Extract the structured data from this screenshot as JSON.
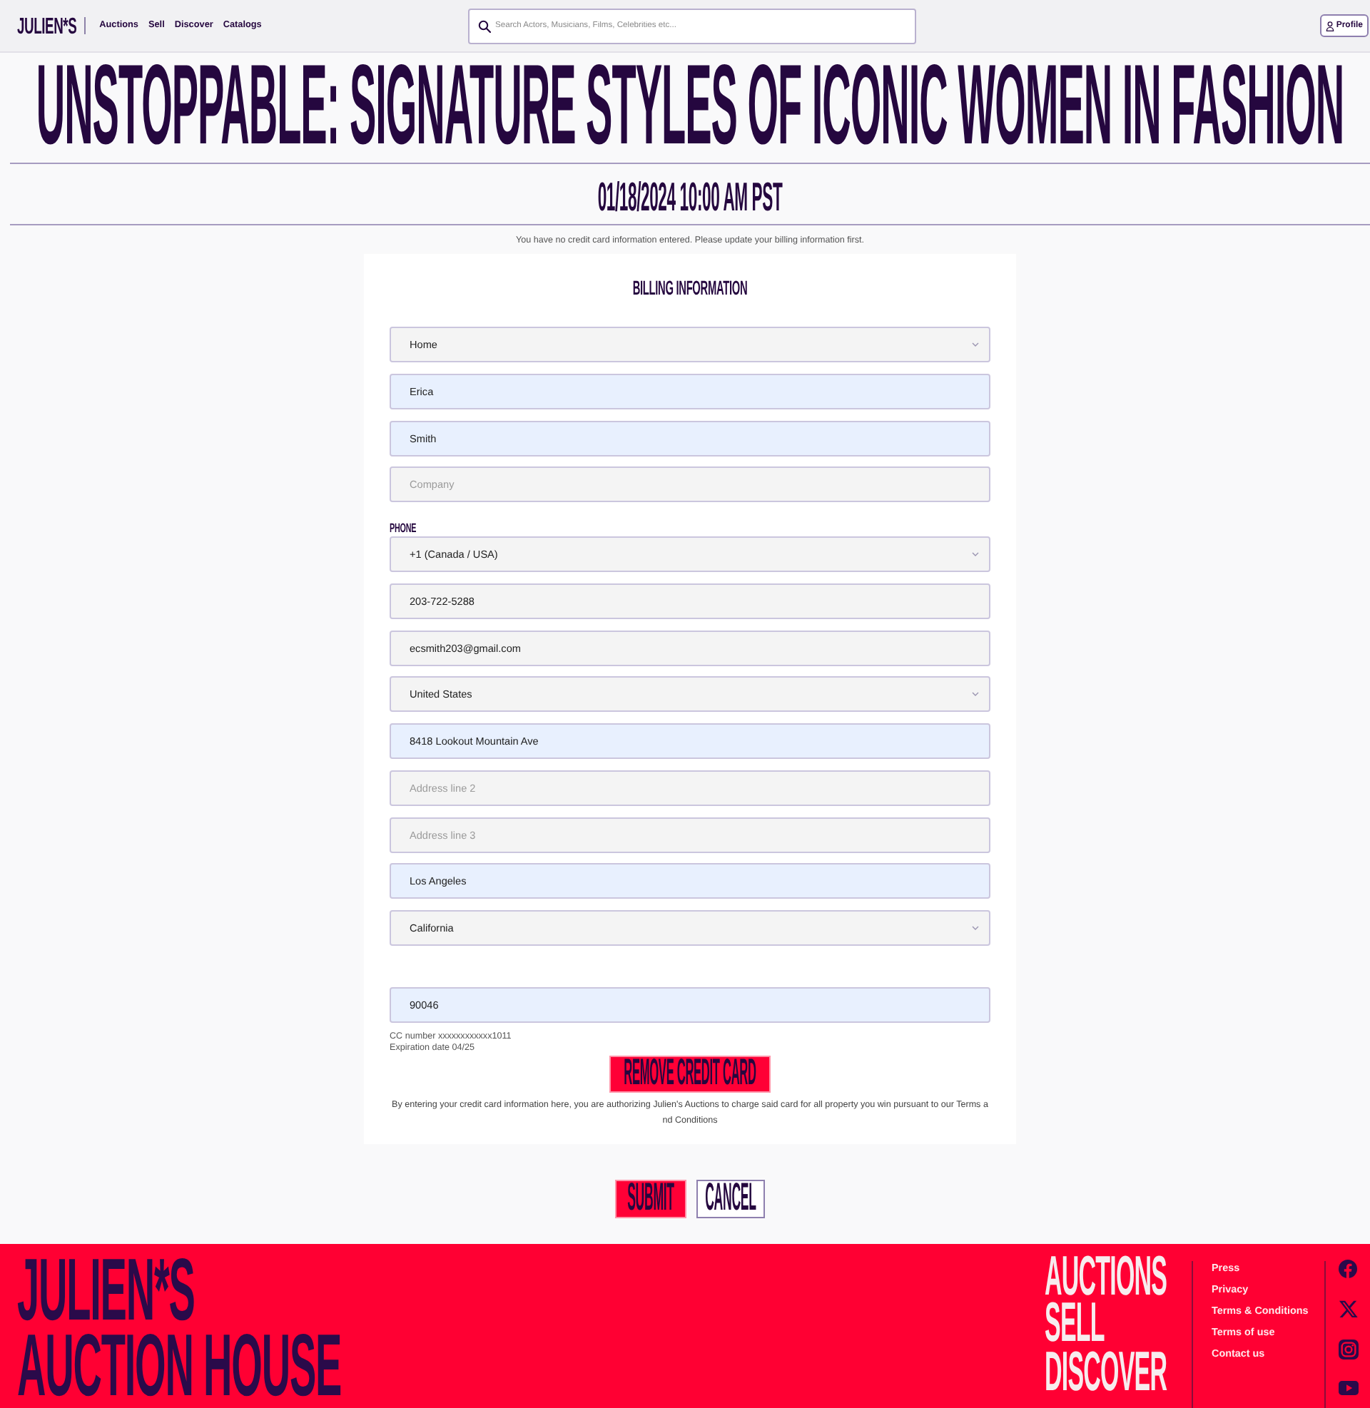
{
  "header": {
    "logo": "JULIEN*S",
    "nav": [
      "Auctions",
      "Sell",
      "Discover",
      "Catalogs"
    ],
    "search": {
      "placeholder": "Search Actors, Musicians, Films, Celebrities etc..."
    },
    "profile": "Profile"
  },
  "banner": {
    "title": "UNSTOPPABLE: SIGNATURE STYLES OF ICONIC WOMEN IN FASHION",
    "date": "01/18/2024 10:00 AM PST"
  },
  "notice": "You have no credit card information entered. Please update your billing information first.",
  "billing": {
    "heading": "BILLING INFORMATION",
    "groups": [
      {
        "fields": [
          {
            "kind": "select",
            "value": "Home",
            "autofilled": false
          },
          {
            "kind": "input",
            "value": "Erica",
            "autofilled": true
          },
          {
            "kind": "input",
            "value": "Smith",
            "autofilled": true
          },
          {
            "kind": "input",
            "placeholder": "Company",
            "autofilled": false
          }
        ]
      },
      {
        "label": "PHONE",
        "fields": [
          {
            "kind": "select",
            "value": "+1 (Canada / USA)",
            "autofilled": false
          },
          {
            "kind": "input",
            "value": "203-722-5288",
            "autofilled": false
          },
          {
            "kind": "input",
            "value": "ecsmith203@gmail.com",
            "autofilled": false
          },
          {
            "kind": "select",
            "value": "United States",
            "autofilled": false
          },
          {
            "kind": "input",
            "value": "8418 Lookout Mountain Ave",
            "autofilled": true
          },
          {
            "kind": "input",
            "placeholder": "Address line 2",
            "autofilled": false
          },
          {
            "kind": "input",
            "placeholder": "Address line 3",
            "autofilled": false
          },
          {
            "kind": "input",
            "value": "Los Angeles",
            "autofilled": true
          },
          {
            "kind": "select",
            "value": "California",
            "autofilled": false
          }
        ]
      },
      {
        "fields": [
          {
            "kind": "input",
            "value": "90046",
            "autofilled": true
          }
        ]
      }
    ],
    "card_info": [
      "CC number xxxxxxxxxxxx1011",
      "Expiration date 04/25"
    ],
    "remove_button": "REMOVE CREDIT CARD",
    "terms": "By entering your credit card information here, you are authorizing Julien's Auctions to charge said card for all property you win pursuant to our Terms and Conditions"
  },
  "actions": [
    {
      "kind": "submit",
      "label": "SUBMIT"
    },
    {
      "kind": "cancel",
      "label": "CANCEL"
    }
  ],
  "footer": {
    "brand": [
      "JULIEN*S",
      "AUCTION HOUSE"
    ],
    "main_links": [
      "AUCTIONS",
      "SELL",
      "DISCOVER"
    ],
    "links": [
      "Press",
      "Privacy",
      "Terms & Conditions",
      "Terms of use",
      "Contact us"
    ]
  }
}
